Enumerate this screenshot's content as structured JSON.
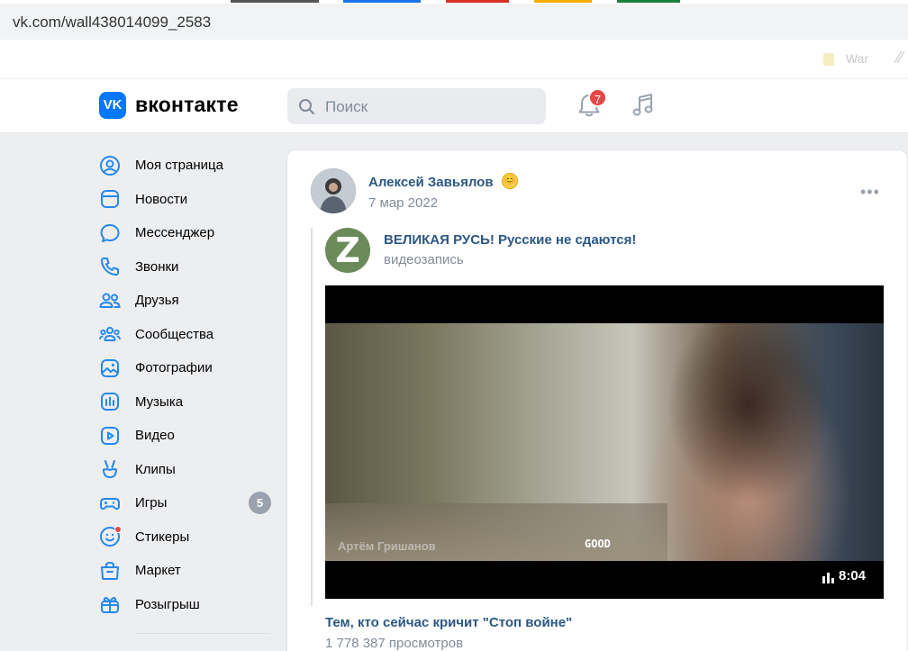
{
  "browser": {
    "url": "vk.com/wall438014099_2583",
    "bookmark_war": "War"
  },
  "header": {
    "logo_mark": "VK",
    "brand": "вконтакте",
    "search_placeholder": "Поиск",
    "notifications_count": "7"
  },
  "sidebar": {
    "items": [
      {
        "label": "Моя страница",
        "icon": "user-circle-icon"
      },
      {
        "label": "Новости",
        "icon": "news-icon"
      },
      {
        "label": "Мессенджер",
        "icon": "message-icon"
      },
      {
        "label": "Звонки",
        "icon": "phone-icon"
      },
      {
        "label": "Друзья",
        "icon": "friends-icon"
      },
      {
        "label": "Сообщества",
        "icon": "communities-icon"
      },
      {
        "label": "Фотографии",
        "icon": "photo-icon"
      },
      {
        "label": "Музыка",
        "icon": "music-icon"
      },
      {
        "label": "Видео",
        "icon": "video-icon"
      },
      {
        "label": "Клипы",
        "icon": "clips-icon"
      },
      {
        "label": "Игры",
        "icon": "games-icon",
        "badge": "5"
      },
      {
        "label": "Стикеры",
        "icon": "stickers-icon"
      },
      {
        "label": "Маркет",
        "icon": "market-icon"
      },
      {
        "label": "Розыгрыш",
        "icon": "gift-icon"
      }
    ]
  },
  "post": {
    "author": "Алексей Завьялов",
    "date": "7 мар 2022",
    "more": "•••",
    "repost": {
      "avatar_letter": "Z",
      "title": "ВЕЛИКАЯ РУСЬ! Русские не сдаются!",
      "subtitle": "видеозапись"
    },
    "video": {
      "watermark": "Артём Гришанов",
      "caption": "GOOD",
      "duration": "8:04",
      "title": "Тем, кто сейчас кричит \"Стоп войне\"",
      "views": "1 778 387 просмотров"
    }
  },
  "colors": {
    "accent": "#2688eb",
    "link": "#2a5885",
    "muted": "#818c99",
    "badge_red": "#e64646",
    "vk_blue": "#0077ff"
  }
}
